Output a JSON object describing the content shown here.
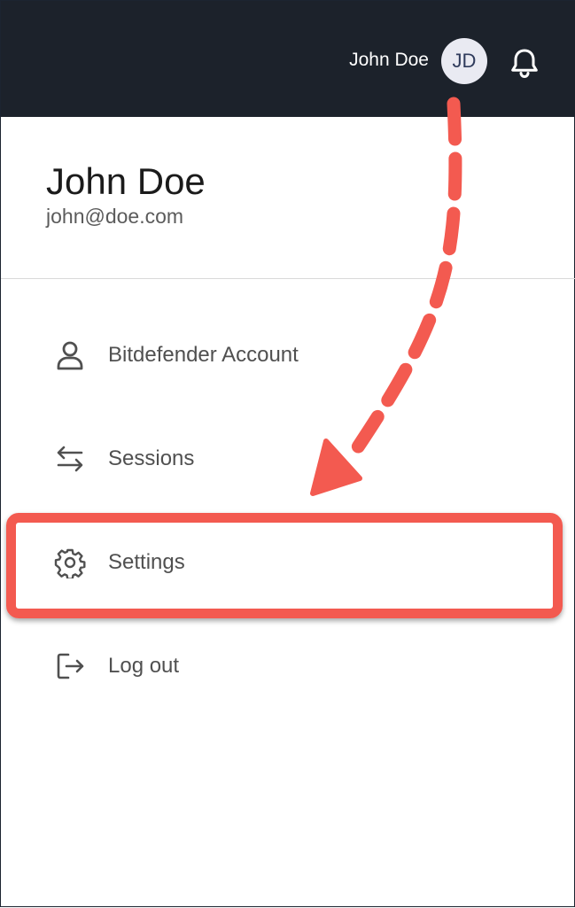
{
  "header": {
    "user_name": "John Doe",
    "avatar_initials": "JD",
    "background_color": "#1c222b"
  },
  "profile": {
    "name": "John Doe",
    "email": "john@doe.com"
  },
  "menu": {
    "items": [
      {
        "id": "bitdefender-account",
        "label": "Bitdefender Account",
        "icon": "user-icon"
      },
      {
        "id": "sessions",
        "label": "Sessions",
        "icon": "arrows-exchange-icon"
      },
      {
        "id": "settings",
        "label": "Settings",
        "icon": "gear-icon"
      },
      {
        "id": "log-out",
        "label": "Log out",
        "icon": "logout-icon"
      }
    ]
  },
  "annotation": {
    "highlighted_item": "settings",
    "color": "#f35a50"
  }
}
